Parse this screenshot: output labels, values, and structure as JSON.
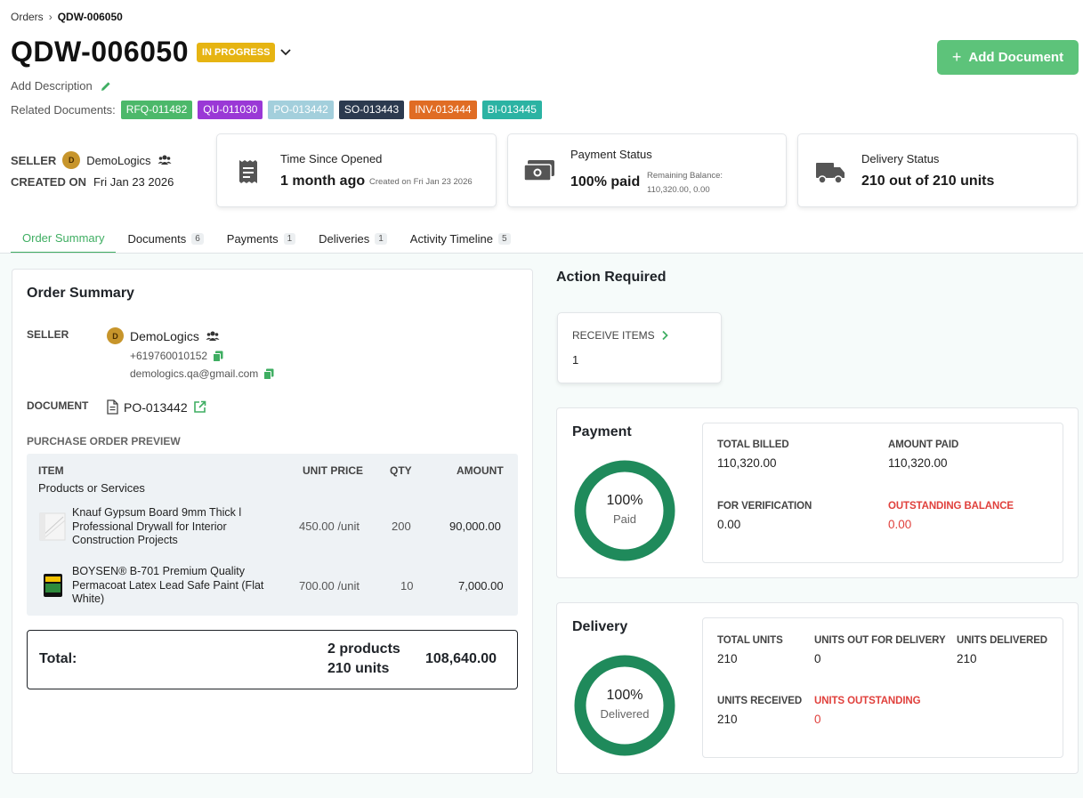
{
  "breadcrumb": {
    "root": "Orders",
    "current": "QDW-006050"
  },
  "order": {
    "title": "QDW-006050",
    "status": "IN PROGRESS",
    "add_description": "Add Description",
    "related_label": "Related Documents:"
  },
  "actions": {
    "add_document": "Add Document"
  },
  "related_documents": [
    {
      "label": "RFQ-011482",
      "color": "#4cb86a"
    },
    {
      "label": "QU-011030",
      "color": "#9a38d6"
    },
    {
      "label": "PO-013442",
      "color": "#a3cfdc"
    },
    {
      "label": "SO-013443",
      "color": "#2c3a4f"
    },
    {
      "label": "INV-013444",
      "color": "#e06c24"
    },
    {
      "label": "BI-013445",
      "color": "#2bb3a3"
    }
  ],
  "info": {
    "seller_label": "SELLER",
    "seller_name": "DemoLogics",
    "seller_initial": "D",
    "created_label": "CREATED ON",
    "created_value": "Fri Jan 23 2026"
  },
  "stats": {
    "time": {
      "title": "Time Since Opened",
      "value": "1 month ago",
      "sub": "Created on Fri Jan 23 2026"
    },
    "payment": {
      "title": "Payment Status",
      "value": "100% paid",
      "sub1": "Remaining Balance:",
      "sub2": "110,320.00, 0.00"
    },
    "delivery": {
      "title": "Delivery Status",
      "value": "210 out of 210 units"
    }
  },
  "tabs": [
    {
      "label": "Order Summary",
      "count": ""
    },
    {
      "label": "Documents",
      "count": "6"
    },
    {
      "label": "Payments",
      "count": "1"
    },
    {
      "label": "Deliveries",
      "count": "1"
    },
    {
      "label": "Activity Timeline",
      "count": "5"
    }
  ],
  "summary": {
    "title": "Order Summary",
    "seller_label": "SELLER",
    "seller_name": "DemoLogics",
    "seller_initial": "D",
    "phone": "+619760010152",
    "email": "demologics.qa@gmail.com",
    "document_label": "DOCUMENT",
    "document_value": "PO-013442",
    "preview_label": "PURCHASE ORDER PREVIEW",
    "columns": {
      "item": "ITEM",
      "item_sub": "Products or Services",
      "unit_price": "UNIT PRICE",
      "qty": "QTY",
      "amount": "AMOUNT"
    },
    "items": [
      {
        "name": "Knauf Gypsum Board 9mm Thick l Professional Drywall for Interior Construction Projects",
        "unit_price": "450.00 /unit",
        "qty": "200",
        "amount": "90,000.00"
      },
      {
        "name": "BOYSEN® B-701 Premium Quality Permacoat Latex Lead Safe Paint (Flat White)",
        "unit_price": "700.00 /unit",
        "qty": "10",
        "amount": "7,000.00"
      }
    ],
    "total_label": "Total:",
    "total_products": "2 products",
    "total_units": "210 units",
    "total_amount": "108,640.00"
  },
  "action_required": {
    "title": "Action Required",
    "card_label": "RECEIVE ITEMS",
    "card_value": "1"
  },
  "payment": {
    "title": "Payment",
    "ring_pct": "100%",
    "ring_sub": "Paid",
    "ring_fraction": 1.0,
    "total_billed_label": "TOTAL BILLED",
    "total_billed": "110,320.00",
    "amount_paid_label": "AMOUNT PAID",
    "amount_paid": "110,320.00",
    "for_verification_label": "FOR VERIFICATION",
    "for_verification": "0.00",
    "outstanding_label": "OUTSTANDING BALANCE",
    "outstanding": "0.00"
  },
  "delivery": {
    "title": "Delivery",
    "ring_pct": "100%",
    "ring_sub": "Delivered",
    "ring_fraction": 1.0,
    "total_units_label": "TOTAL UNITS",
    "total_units": "210",
    "out_label": "UNITS OUT FOR DELIVERY",
    "out": "0",
    "delivered_label": "UNITS DELIVERED",
    "delivered": "210",
    "received_label": "UNITS RECEIVED",
    "received": "210",
    "outstanding_label": "UNITS OUTSTANDING",
    "outstanding": "0"
  },
  "colors": {
    "accent": "#3fae62",
    "ring": "#1f8a5b",
    "danger": "#e0403c",
    "status": "#e6b412"
  }
}
